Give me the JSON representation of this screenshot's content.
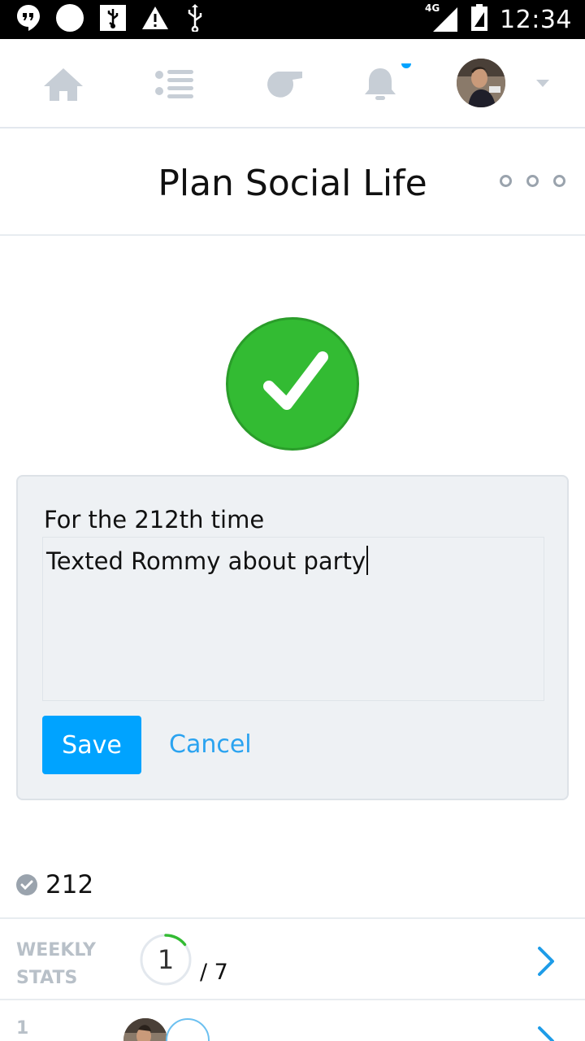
{
  "status_bar": {
    "time": "12:34",
    "network": "4G",
    "icons": [
      "hangouts-icon",
      "circle-icon",
      "usb-debug-icon",
      "warning-icon",
      "usb-icon",
      "signal-icon",
      "battery-icon"
    ]
  },
  "nav": {
    "items": [
      "home-icon",
      "list-icon",
      "whistle-icon",
      "bell-icon"
    ],
    "has_notification": true,
    "accent_color": "#00a3ff"
  },
  "header": {
    "title": "Plan Social Life"
  },
  "checkin": {
    "status": "done",
    "color": "#33bb33"
  },
  "note_card": {
    "heading": "For the 212th time",
    "note_value": "Texted Rommy about party",
    "save_label": "Save",
    "cancel_label": "Cancel"
  },
  "summary": {
    "count": "212"
  },
  "weekly_stats": {
    "label_line1": "WEEKLY",
    "label_line2": "STATS",
    "done": "1",
    "total": "/ 7",
    "progress_fraction": 0.142857
  },
  "next_row": {
    "label": "1"
  }
}
